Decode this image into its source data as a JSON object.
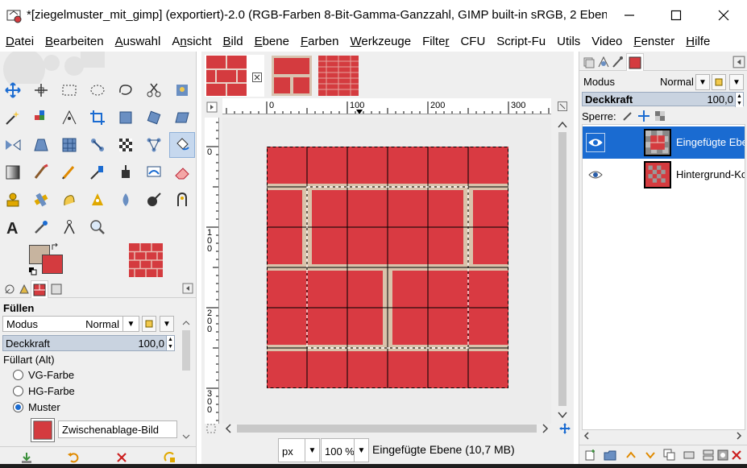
{
  "window": {
    "title": "*[ziegelmuster_mit_gimp] (exportiert)-2.0 (RGB-Farben 8-Bit-Gamma-Ganzzahl, GIMP built-in sRGB, 2 Eben...",
    "min_glyph": "—",
    "max_glyph": "☐",
    "close_glyph": "✕"
  },
  "menu": [
    {
      "label": "Datei",
      "key": "D"
    },
    {
      "label": "Bearbeiten",
      "key": "B"
    },
    {
      "label": "Auswahl",
      "key": "A"
    },
    {
      "label": "Ansicht",
      "key": "n"
    },
    {
      "label": "Bild",
      "key": "B"
    },
    {
      "label": "Ebene",
      "key": "E"
    },
    {
      "label": "Farben",
      "key": "F"
    },
    {
      "label": "Werkzeuge",
      "key": "W"
    },
    {
      "label": "Filter",
      "key": "r"
    },
    {
      "label": "CFU",
      "key": ""
    },
    {
      "label": "Script-Fu",
      "key": ""
    },
    {
      "label": "Utils",
      "key": ""
    },
    {
      "label": "Video",
      "key": ""
    },
    {
      "label": "Fenster",
      "key": "F"
    },
    {
      "label": "Hilfe",
      "key": "H"
    }
  ],
  "toolbox": {
    "tools": [
      "move-tool-icon",
      "align-tool-icon",
      "rect-select-icon",
      "ellipse-select-icon",
      "free-select-icon",
      "scissors-select-icon",
      "foreground-select-icon",
      "fuzzy-select-icon",
      "color-select-icon",
      "paths-tool-icon",
      "crop-tool-icon",
      "unified-transform-icon",
      "rotate-tool-icon",
      "shear-tool-icon",
      "flip-tool-icon",
      "perspective-tool-icon",
      "cage-transform-icon",
      "warp-transform-icon",
      "3d-transform-icon",
      "handle-transform-icon",
      "bucket-fill-icon",
      "gradient-tool-icon",
      "paintbrush-icon",
      "pencil-icon",
      "airbrush-icon",
      "ink-tool-icon",
      "mypaint-brush-icon",
      "eraser-icon",
      "clone-tool-icon",
      "heal-tool-icon",
      "smudge-tool-icon",
      "perspective-clone-icon",
      "blur-sharpen-icon",
      "dodge-burn-icon",
      "mypaint-icon",
      "text-tool-icon",
      "color-picker-icon",
      "measure-tool-icon",
      "zoom-tool-icon"
    ],
    "active_tool": "bucket-fill-icon",
    "fg_color": "#c7b49f",
    "bg_color": "#d43b3f"
  },
  "tool_options": {
    "title": "Füllen",
    "mode_label": "Modus",
    "mode_value": "Normal",
    "opacity_label": "Deckkraft",
    "opacity_value": "100,0",
    "fill_type_label": "Füllart  (Alt)",
    "options": [
      {
        "label": "VG-Farbe",
        "checked": false
      },
      {
        "label": "HG-Farbe",
        "checked": false
      },
      {
        "label": "Muster",
        "checked": true
      }
    ],
    "pattern_name": "Zwischenablage-Bild"
  },
  "canvas": {
    "h_ruler_labels": [
      "0",
      "100",
      "200",
      "300"
    ],
    "v_ruler_labels": [
      "0",
      "1\n0\n0",
      "2\n0\n0",
      "3\n0\n0"
    ],
    "unit": "px",
    "zoom": "100 %",
    "status": "Eingefügte Ebene (10,7 MB)"
  },
  "layers": {
    "mode_label": "Modus",
    "mode_value": "Normal",
    "opacity_label": "Deckkraft",
    "opacity_value": "100,0",
    "lock_label": "Sperre:",
    "items": [
      {
        "name": "Eingefügte Ebene",
        "selected": true,
        "visible": true
      },
      {
        "name": "Hintergrund-Kopie",
        "selected": false,
        "visible": true
      }
    ]
  }
}
